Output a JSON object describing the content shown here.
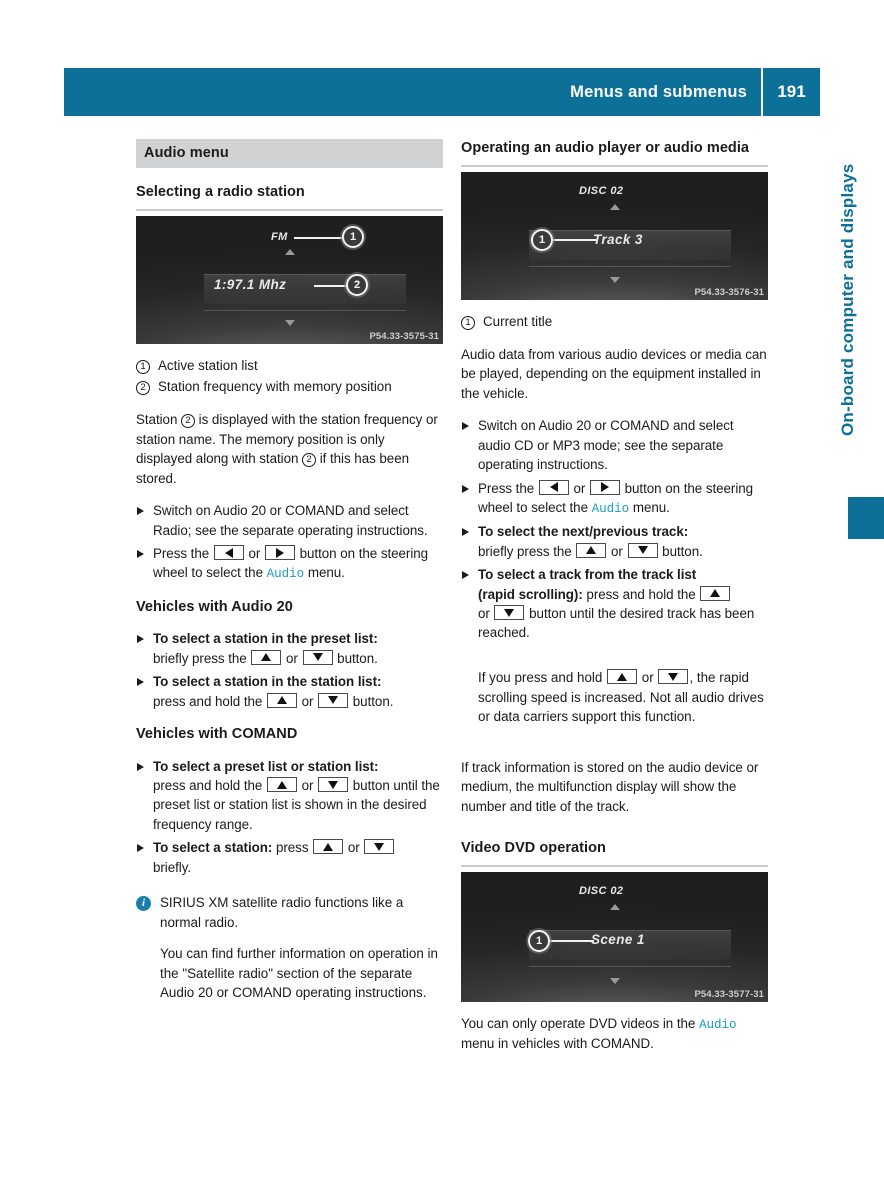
{
  "header": {
    "title": "Menus and submenus",
    "page_number": "191"
  },
  "side_tab": {
    "label": "On-board computer and displays",
    "accent_color": "#0d7099"
  },
  "left_column": {
    "section_band": "Audio menu",
    "heading": "Selecting a radio station",
    "figure": {
      "top_label": "FM",
      "main_label": "1:97.1 Mhz",
      "code": "P54.33-3575-31",
      "callouts": [
        "1",
        "2"
      ]
    },
    "legend": [
      {
        "num": "1",
        "text": "Active station list"
      },
      {
        "num": "2",
        "text": "Station frequency with memory position"
      }
    ],
    "paragraph_1_parts": [
      "Station ",
      "2",
      " is displayed with the station frequency or station name. The memory position is only displayed along with station ",
      "2",
      " if this has been stored."
    ],
    "bullet_switch_on": "Switch on Audio 20 or COMAND and select Radio; see the separate operating instructions.",
    "bullet_press_pre": "Press the",
    "bullet_press_or": "or",
    "bullet_press_mid": "button on the steering wheel to select the",
    "bullet_press_menu": "Audio",
    "bullet_press_post": "menu.",
    "subhead_audio20": "Vehicles with Audio 20",
    "audio20_items": [
      {
        "bold": "To select a station in the preset list:",
        "pre": "briefly press the",
        "or": "or",
        "post": "button."
      },
      {
        "bold": "To select a station in the station list:",
        "pre": "press and hold the",
        "or": "or",
        "post": "button."
      }
    ],
    "subhead_comand": "Vehicles with COMAND",
    "comand_items": [
      {
        "bold": "To select a preset list or station list:",
        "pre": "press and hold the",
        "or": "or",
        "post": "button until the preset list or station list is shown in the desired frequency range."
      },
      {
        "bold": "To select a station:",
        "pre": "press",
        "or": "or",
        "post": "briefly."
      }
    ],
    "note": {
      "icon": "info-icon",
      "paragraph_1": "SIRIUS XM satellite radio functions like a normal radio.",
      "paragraph_2": "You can find further information on operation in the \"Satellite radio\" section of the separate Audio 20 or COMAND operating instructions."
    }
  },
  "right_column": {
    "heading_1": "Operating an audio player or audio media",
    "figure_1": {
      "top_label": "DISC 02",
      "main_label": "Track 3",
      "code": "P54.33-3576-31",
      "callouts": [
        "1"
      ]
    },
    "legend": [
      {
        "num": "1",
        "text": "Current title"
      }
    ],
    "paragraph_1": "Audio data from various audio devices or media can be played, depending on the equipment installed in the vehicle.",
    "bullet_switch_on": "Switch on Audio 20 or COMAND and select audio CD or MP3 mode; see the separate operating instructions.",
    "bullet_press_pre": "Press the",
    "bullet_press_or": "or",
    "bullet_press_mid": "button on the steering wheel to select the",
    "bullet_press_menu": "Audio",
    "bullet_press_post": "menu.",
    "track_items": [
      {
        "bold": "To select the next/previous track:",
        "pre": "briefly press the",
        "or": "or",
        "post": "button."
      },
      {
        "bold_line1": "To select a track from the track list",
        "bold_line2": "(rapid scrolling):",
        "pre": "press and hold the",
        "or": "or",
        "post": "button until the desired track has been reached."
      }
    ],
    "rapid_note_pre": "If you press and hold",
    "rapid_note_or": "or",
    "rapid_note_post": ", the rapid scrolling speed is increased. Not all audio drives or data carriers support this function.",
    "paragraph_2": "If track information is stored on the audio device or medium, the multifunction display will show the number and title of the track.",
    "heading_2": "Video DVD operation",
    "figure_2": {
      "top_label": "DISC 02",
      "main_label": "Scene 1",
      "code": "P54.33-3577-31",
      "callouts": [
        "1"
      ]
    },
    "closing_pre": "You can only operate DVD videos in the",
    "closing_menu": "Audio",
    "closing_post": "menu in vehicles with COMAND."
  }
}
